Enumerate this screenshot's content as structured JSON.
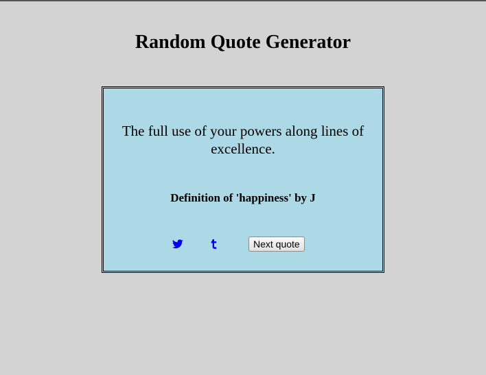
{
  "page": {
    "title": "Random Quote Generator",
    "background_color": "#d3d3d3"
  },
  "quote_box": {
    "background_color": "#add8e6",
    "quote": "The full use of your powers along lines of excellence.",
    "author": "Definition of 'happiness' by J"
  },
  "controls": {
    "twitter_icon": "twitter-bird-icon",
    "tumblr_icon": "tumblr-t-icon",
    "link_color": "#0000ee",
    "next_button_label": "Next quote"
  }
}
